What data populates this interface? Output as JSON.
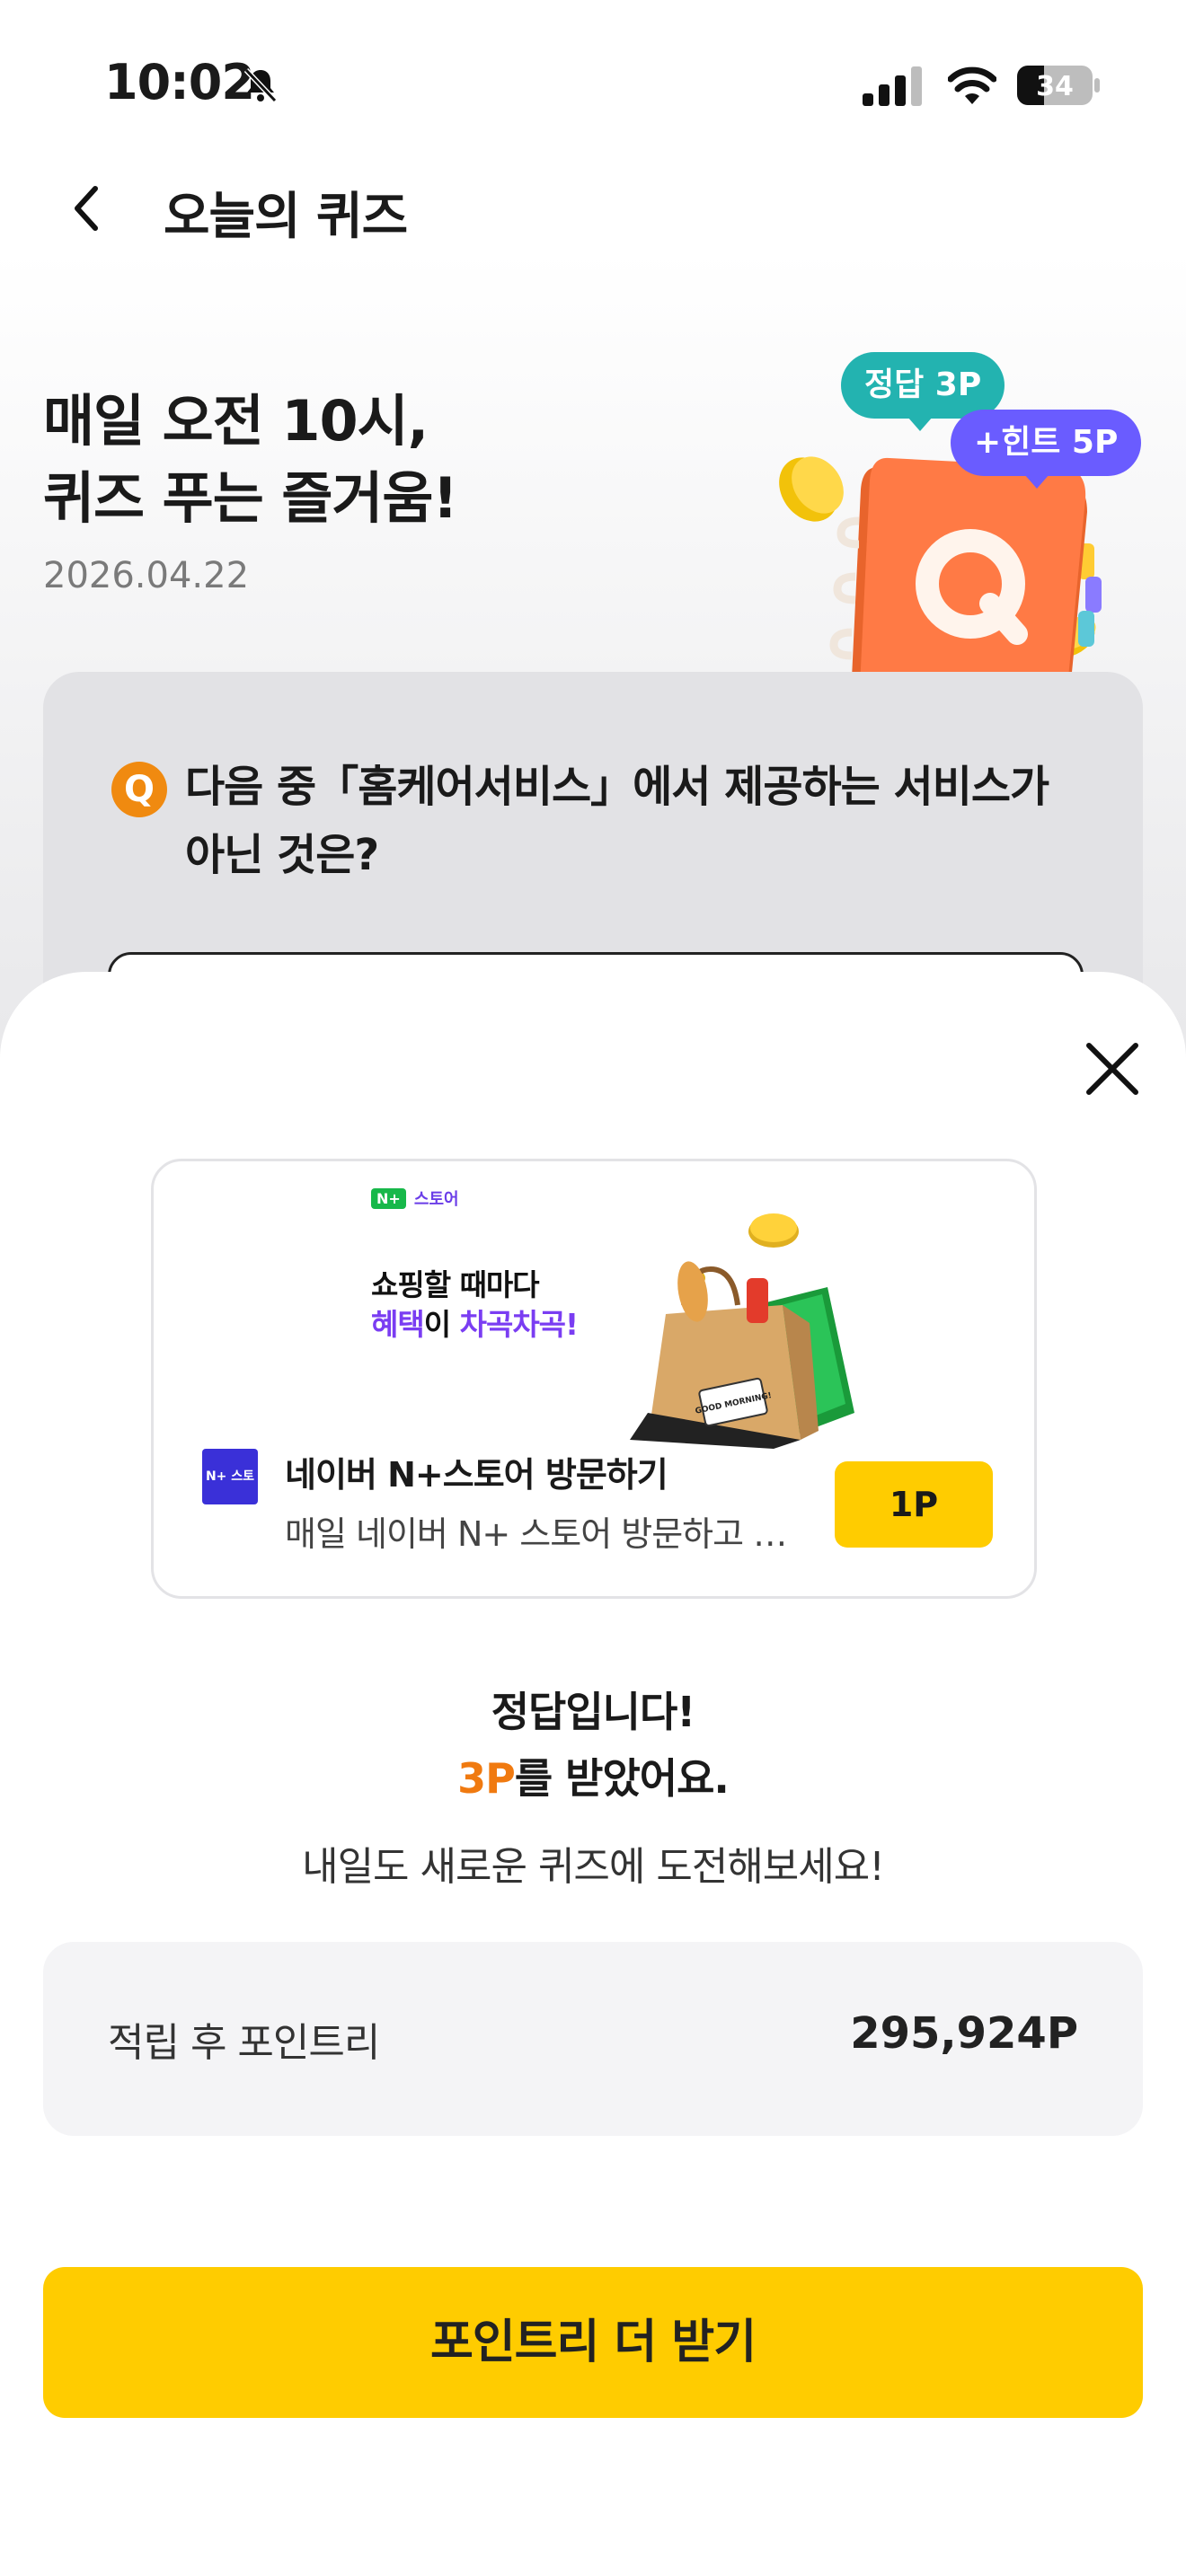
{
  "status_bar": {
    "time": "10:02",
    "battery": "34"
  },
  "header": {
    "title": "오늘의 퀴즈"
  },
  "hero": {
    "title_line1": "매일 오전 10시,",
    "title_line2": "퀴즈 푸는 즐거움!",
    "date": "2026.04.22",
    "badge_answer": "정답 3P",
    "badge_hint": "+힌트 5P",
    "quiz_book_letter": "Q"
  },
  "question": {
    "icon_letter": "Q",
    "text": "다음 중「홈케어서비스」에서 제공하는 서비스가 아닌 것은?"
  },
  "ad": {
    "brand_logo": "N+",
    "brand_name": "스토어",
    "headline_1": "쇼핑할 때마다",
    "headline_2_a": "혜택",
    "headline_2_b": "이 ",
    "headline_2_c": "차곡차곡!",
    "illustration_tag": "GOOD MORNING!",
    "logo_text": "N+ 스토어",
    "title": "네이버 N+스토어 방문하기",
    "description": "매일 네이버 N+ 스토어 방문하고 포인트 받기",
    "reward_button": "1P"
  },
  "result": {
    "line1": "정답입니다!",
    "points": "3P",
    "line2_suffix": "를 받았어요.",
    "line3": "내일도 새로운 퀴즈에 도전해보세요!"
  },
  "balance": {
    "label": "적립 후 포인트리",
    "value": "295,924P"
  },
  "cta": {
    "label": "포인트리 더 받기"
  },
  "colors": {
    "accent_yellow": "#ffcc00",
    "accent_orange": "#f07a10",
    "badge_teal": "#23b3b0",
    "badge_purple": "#6a5cff"
  }
}
